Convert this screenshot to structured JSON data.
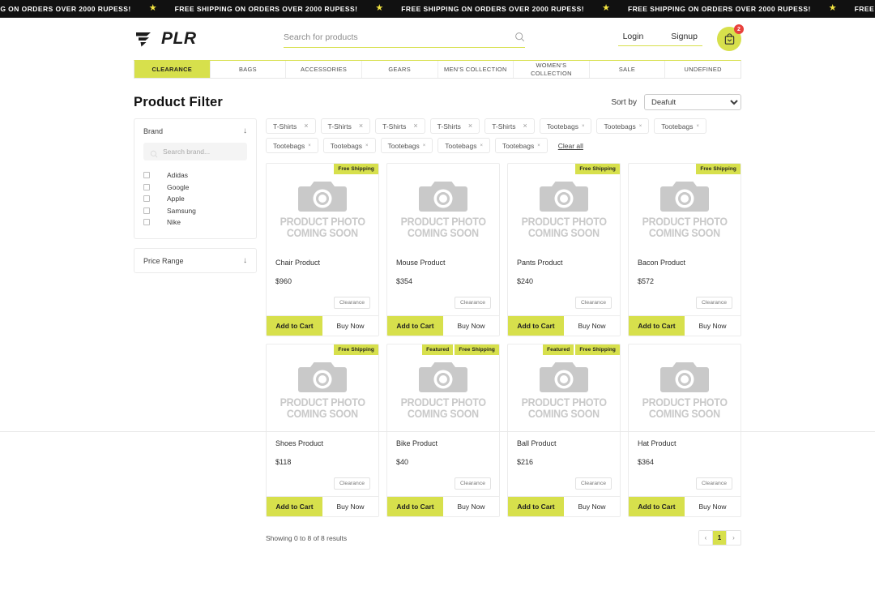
{
  "announcement": {
    "message": "FREE SHIPPING ON ORDERS OVER 2000 Rupess!",
    "star_icon": "star-icon",
    "repeat": 6
  },
  "header": {
    "brand_name": "PLR",
    "logo_icon": "plr-logo-icon",
    "search": {
      "placeholder": "Search for products",
      "value": "",
      "icon": "search-icon"
    },
    "login_label": "Login",
    "signup_label": "Signup",
    "cart": {
      "icon": "cart-bag-icon",
      "count": "2"
    }
  },
  "nav": {
    "items": [
      {
        "label": "CLEARANCE",
        "active": true
      },
      {
        "label": "BAGS",
        "active": false
      },
      {
        "label": "ACCESSORIES",
        "active": false
      },
      {
        "label": "GEARS",
        "active": false
      },
      {
        "label": "MEN'S COLLECTION",
        "active": false
      },
      {
        "label": "WOMEN'S COLLECTION",
        "active": false
      },
      {
        "label": "SALE",
        "active": false
      },
      {
        "label": "UNDEFINED",
        "active": false
      }
    ]
  },
  "page": {
    "title": "Product Filter",
    "sort": {
      "label": "Sort by",
      "selected": "Deafult",
      "options": [
        "Deafult"
      ]
    }
  },
  "sidebar": {
    "brand_filter": {
      "title": "Brand",
      "collapse_icon": "arrow-down-icon",
      "search_placeholder": "Search brand...",
      "search_icon": "search-icon",
      "search_value": "",
      "options": [
        {
          "label": "Adidas",
          "checked": false
        },
        {
          "label": "Google",
          "checked": false
        },
        {
          "label": "Apple",
          "checked": false
        },
        {
          "label": "Samsung",
          "checked": false
        },
        {
          "label": "Nike",
          "checked": false
        }
      ]
    },
    "price_filter": {
      "title": "Price Range",
      "collapse_icon": "arrow-down-icon"
    }
  },
  "filter_chips": {
    "items": [
      {
        "label": "T-Shirts",
        "style": "large-x"
      },
      {
        "label": "T-Shirts",
        "style": "large-x"
      },
      {
        "label": "T-Shirts",
        "style": "large-x"
      },
      {
        "label": "T-Shirts",
        "style": "large-x"
      },
      {
        "label": "T-Shirts",
        "style": "large-x"
      },
      {
        "label": "Tootebags",
        "style": "small-x"
      },
      {
        "label": "Tootebags",
        "style": "small-x"
      },
      {
        "label": "Tootebags",
        "style": "small-x"
      },
      {
        "label": "Tootebags",
        "style": "small-x"
      },
      {
        "label": "Tootebags",
        "style": "small-x"
      },
      {
        "label": "Tootebags",
        "style": "small-x"
      },
      {
        "label": "Tootebags",
        "style": "small-x"
      },
      {
        "label": "Tootebags",
        "style": "small-x"
      }
    ],
    "remove_icon": "close-x-icon",
    "clear_all_label": "Clear all"
  },
  "products": {
    "placeholder_text_line1": "PRODUCT PHOTO",
    "placeholder_text_line2": "COMING SOON",
    "placeholder_icon": "camera-icon",
    "add_to_cart_label": "Add to Cart",
    "buy_now_label": "Buy Now",
    "items": [
      {
        "name": "Chair Product",
        "price": "$960",
        "tag": "Clearance",
        "badges": [
          "Free Shipping"
        ]
      },
      {
        "name": "Mouse Product",
        "price": "$354",
        "tag": "Clearance",
        "badges": []
      },
      {
        "name": "Pants Product",
        "price": "$240",
        "tag": "Clearance",
        "badges": [
          "Free Shipping"
        ]
      },
      {
        "name": "Bacon Product",
        "price": "$572",
        "tag": "Clearance",
        "badges": [
          "Free Shipping"
        ]
      },
      {
        "name": "Shoes Product",
        "price": "$118",
        "tag": "Clearance",
        "badges": [
          "Free Shipping"
        ]
      },
      {
        "name": "Bike Product",
        "price": "$40",
        "tag": "Clearance",
        "badges": [
          "Featured",
          "Free Shipping"
        ]
      },
      {
        "name": "Ball Product",
        "price": "$216",
        "tag": "Clearance",
        "badges": [
          "Featured",
          "Free Shipping"
        ]
      },
      {
        "name": "Hat Product",
        "price": "$364",
        "tag": "Clearance",
        "badges": []
      }
    ]
  },
  "pagination": {
    "results_text": "Showing 0 to 8 of 8 results",
    "prev_icon": "chevron-left-icon",
    "next_icon": "chevron-right-icon",
    "pages": [
      {
        "label": "1",
        "active": true
      }
    ]
  },
  "colors": {
    "accent": "#d7e04c",
    "badge_red": "#e8413c",
    "dark_bar": "#111111",
    "placeholder_gray": "#c9c9c9"
  }
}
